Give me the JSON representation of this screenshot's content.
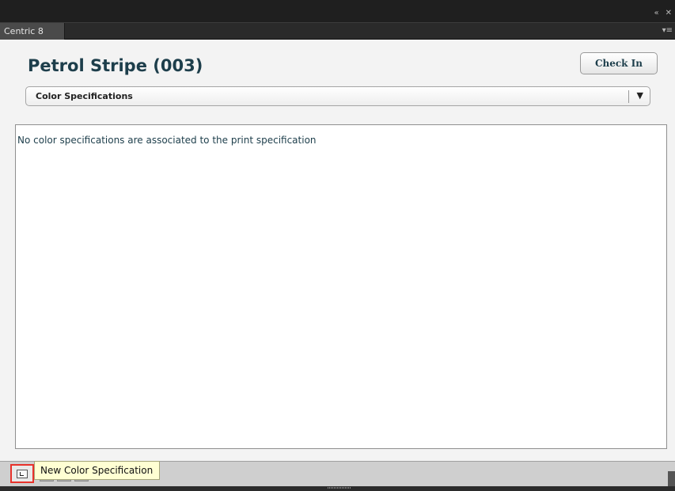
{
  "window": {
    "collapse_glyph": "«",
    "close_glyph": "✕",
    "panel_menu_glyph": "▾≡"
  },
  "tab": {
    "label": "Centric 8"
  },
  "header": {
    "title": "Petrol Stripe (003)",
    "check_in_label": "Check In"
  },
  "section_select": {
    "selected": "Color Specifications",
    "arrow_glyph": "▼"
  },
  "list": {
    "empty_message": "No color specifications are associated to the print specification"
  },
  "toolbar": {
    "new_button_icon": "new-document-icon",
    "tooltip": "New Color Specification"
  },
  "colors": {
    "title_color": "#1d3e4b",
    "highlight_border": "#e8322b",
    "tooltip_bg": "#ffffd3"
  }
}
